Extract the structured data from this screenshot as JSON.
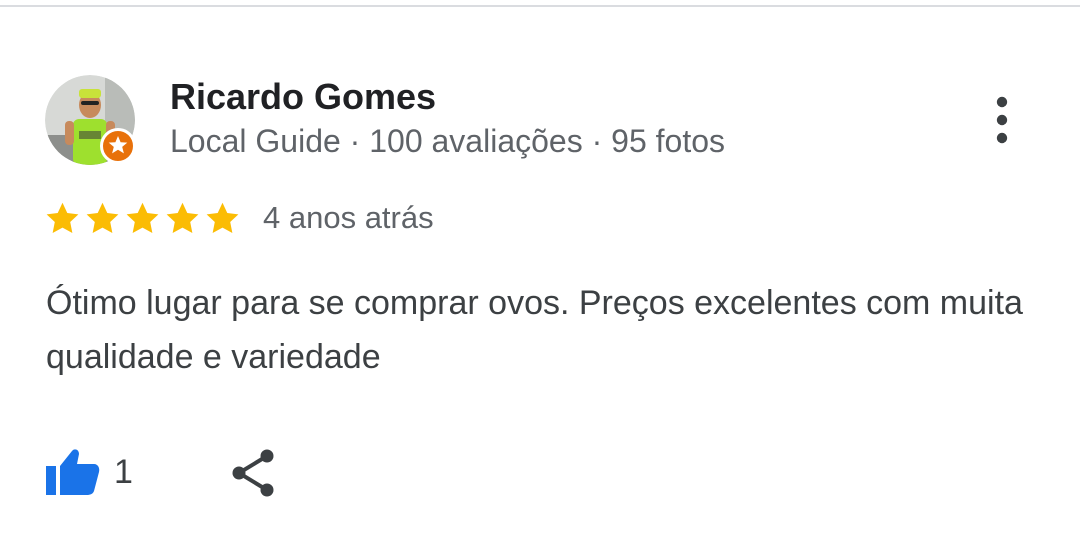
{
  "reviewer": {
    "name": "Ricardo Gomes",
    "meta": "Local Guide · 100 avaliações · 95 fotos",
    "avatar_icon": "person-photo-avatar",
    "badge_icon": "local-guide-star-badge",
    "badge_color": "#e8710a"
  },
  "rating": {
    "stars": 5,
    "max": 5,
    "star_color": "#fbbc04",
    "date": "4 anos atrás"
  },
  "review": {
    "text": "Ótimo lugar para se comprar ovos. Preços excelentes com muita qualidade e variedade"
  },
  "actions": {
    "like_count": "1",
    "like_icon": "thumbs-up-icon",
    "like_color": "#1a73e8",
    "share_icon": "share-icon",
    "more_icon": "more-vert-icon"
  }
}
